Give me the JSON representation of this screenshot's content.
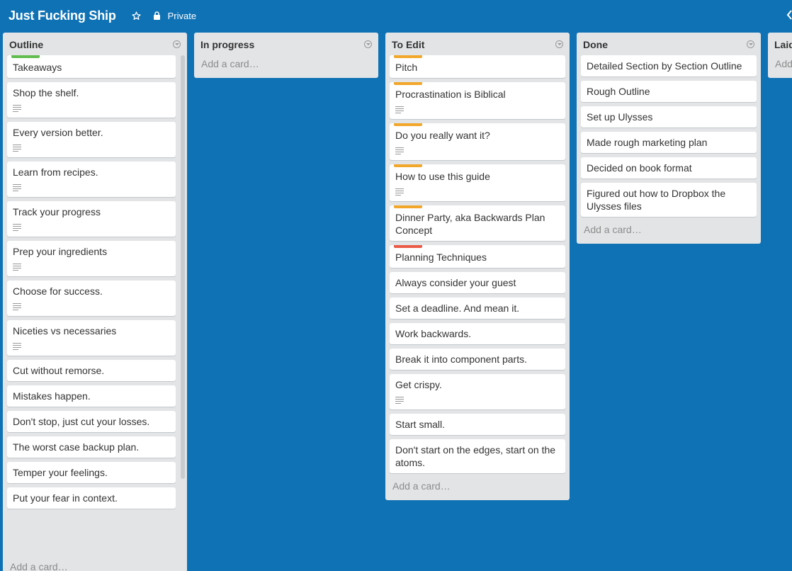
{
  "board": {
    "title": "Just Fucking Ship",
    "privacy": "Private"
  },
  "colors": {
    "background": "#0f72b5",
    "label_green": "#61bd4f",
    "label_orange": "#f2a72b",
    "label_red": "#eb5a46"
  },
  "lists": [
    {
      "title": "Outline",
      "add_card": "Add a card…",
      "cards": [
        {
          "text": "Takeaways",
          "label": "green",
          "desc": false
        },
        {
          "text": "Shop the shelf.",
          "label": null,
          "desc": true
        },
        {
          "text": "Every version better.",
          "label": null,
          "desc": true
        },
        {
          "text": "Learn from recipes.",
          "label": null,
          "desc": true
        },
        {
          "text": "Track your progress",
          "label": null,
          "desc": true
        },
        {
          "text": "Prep your ingredients",
          "label": null,
          "desc": true
        },
        {
          "text": "Choose for success.",
          "label": null,
          "desc": true
        },
        {
          "text": "Niceties vs necessaries",
          "label": null,
          "desc": true
        },
        {
          "text": "Cut without remorse.",
          "label": null,
          "desc": false
        },
        {
          "text": "Mistakes happen.",
          "label": null,
          "desc": false
        },
        {
          "text": "Don't stop, just cut your losses.",
          "label": null,
          "desc": false
        },
        {
          "text": "The worst case backup plan.",
          "label": null,
          "desc": false
        },
        {
          "text": "Temper your feelings.",
          "label": null,
          "desc": false
        },
        {
          "text": "Put your fear in context.",
          "label": null,
          "desc": false
        }
      ]
    },
    {
      "title": "In progress",
      "add_card": "Add a card…",
      "cards": []
    },
    {
      "title": "To Edit",
      "add_card": "Add a card…",
      "cards": [
        {
          "text": "Pitch",
          "label": "orange",
          "desc": false
        },
        {
          "text": "Procrastination is Biblical",
          "label": "orange",
          "desc": true
        },
        {
          "text": "Do you really want it?",
          "label": "orange",
          "desc": true
        },
        {
          "text": "How to use this guide",
          "label": "orange",
          "desc": true
        },
        {
          "text": "Dinner Party, aka Backwards Plan Concept",
          "label": "orange",
          "desc": false
        },
        {
          "text": "Planning Techniques",
          "label": "red",
          "desc": false
        },
        {
          "text": "Always consider your guest",
          "label": null,
          "desc": false
        },
        {
          "text": "Set a deadline. And mean it.",
          "label": null,
          "desc": false
        },
        {
          "text": "Work backwards.",
          "label": null,
          "desc": false
        },
        {
          "text": "Break it into component parts.",
          "label": null,
          "desc": false
        },
        {
          "text": "Get crispy.",
          "label": null,
          "desc": true
        },
        {
          "text": "Start small.",
          "label": null,
          "desc": false
        },
        {
          "text": "Don't start on the edges, start on the atoms.",
          "label": null,
          "desc": false
        }
      ]
    },
    {
      "title": "Done",
      "add_card": "Add a card…",
      "cards": [
        {
          "text": "Detailed Section by Section Outline",
          "label": null,
          "desc": false
        },
        {
          "text": "Rough Outline",
          "label": null,
          "desc": false
        },
        {
          "text": "Set up Ulysses",
          "label": null,
          "desc": false
        },
        {
          "text": "Made rough marketing plan",
          "label": null,
          "desc": false
        },
        {
          "text": "Decided on book format",
          "label": null,
          "desc": false
        },
        {
          "text": "Figured out how to Dropbox the Ulysses files",
          "label": null,
          "desc": false
        }
      ]
    },
    {
      "title": "Laid",
      "add_card": "Add",
      "cards": []
    }
  ]
}
